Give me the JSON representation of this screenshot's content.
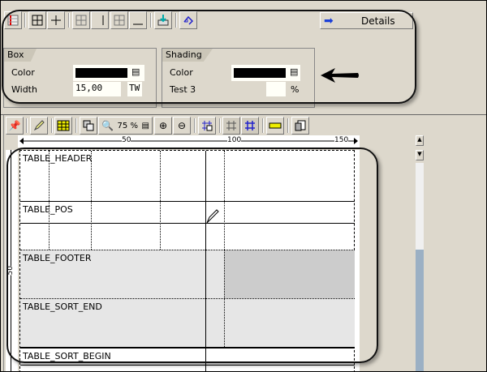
{
  "top_toolbar": {
    "buttons": [
      "table-layout-icon",
      "grid-icon",
      "plus-lines-icon",
      "grid-outer-icon",
      "vertical-line-icon",
      "grid-inner-icon",
      "underline-icon",
      "download-icon",
      "undo-icon"
    ],
    "details_label": "Details"
  },
  "box": {
    "title": "Box",
    "color_label": "Color",
    "color_value": "#000000",
    "width_label": "Width",
    "width_value": "15,00",
    "width_unit": "TW"
  },
  "shading": {
    "title": "Shading",
    "color_label": "Color",
    "color_value": "#000000",
    "test_label": "Test 3",
    "test_value": "",
    "test_unit": "%"
  },
  "editor_toolbar": {
    "zoom": "75 %"
  },
  "ruler": {
    "ticks": [
      "50",
      "100",
      "150"
    ],
    "vertical_tick": "50"
  },
  "table": {
    "rows": [
      "TABLE_HEADER",
      "TABLE_POS",
      "TABLE_FOOTER",
      "TABLE_SORT_END",
      "TABLE_SORT_BEGIN"
    ]
  }
}
